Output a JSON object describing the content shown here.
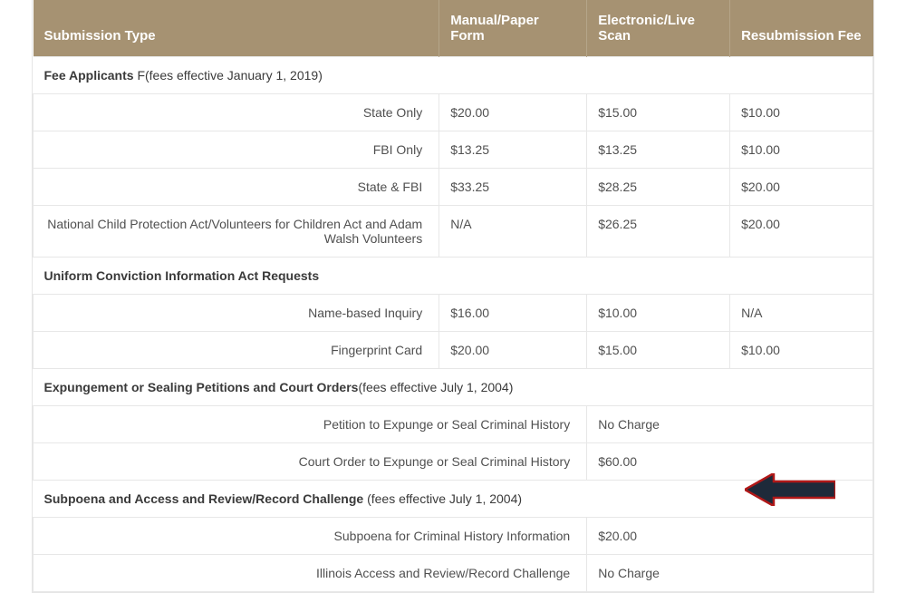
{
  "headers": {
    "col1": "Submission Type",
    "col2": "Manual/Paper Form",
    "col3": "Electronic/Live Scan",
    "col4": "Resubmission Fee"
  },
  "sections": [
    {
      "title": "Fee Applicants",
      "note": " F(fees effective January 1, 2019)",
      "rows": [
        {
          "label": "State Only",
          "c2": "$20.00",
          "c3": "$15.00",
          "c4": "$10.00"
        },
        {
          "label": "FBI Only",
          "c2": "$13.25",
          "c3": "$13.25",
          "c4": "$10.00"
        },
        {
          "label": "State & FBI",
          "c2": "$33.25",
          "c3": "$28.25",
          "c4": "$20.00"
        },
        {
          "label": "National Child Protection Act/Volunteers for Children Act and Adam Walsh Volunteers",
          "c2": "N/A",
          "c3": "$26.25",
          "c4": "$20.00"
        }
      ]
    },
    {
      "title": "Uniform Conviction Information Act Requests",
      "note": "",
      "rows": [
        {
          "label": "Name-based Inquiry",
          "c2": "$16.00",
          "c3": "$10.00",
          "c4": "N/A"
        },
        {
          "label": "Fingerprint Card",
          "c2": "$20.00",
          "c3": "$15.00",
          "c4": "$10.00"
        }
      ]
    },
    {
      "title": "Expungement or Sealing Petitions and Court Orders",
      "note": "(fees effective July 1, 2004)",
      "rows_wide": [
        {
          "label": "Petition to Expunge or Seal Criminal History",
          "value": "No Charge"
        },
        {
          "label": "Court Order to Expunge or Seal Criminal History",
          "value": "$60.00"
        }
      ]
    },
    {
      "title": "Subpoena and Access and Review/Record Challenge",
      "note": " (fees effective July 1, 2004)",
      "rows_wide": [
        {
          "label": "Subpoena for Criminal History Information",
          "value": "$20.00"
        },
        {
          "label": "Illinois Access and Review/Record Challenge",
          "value": "No Charge"
        }
      ]
    }
  ],
  "arrow": {
    "fill": "#1e2a3a",
    "stroke": "#b01818"
  }
}
